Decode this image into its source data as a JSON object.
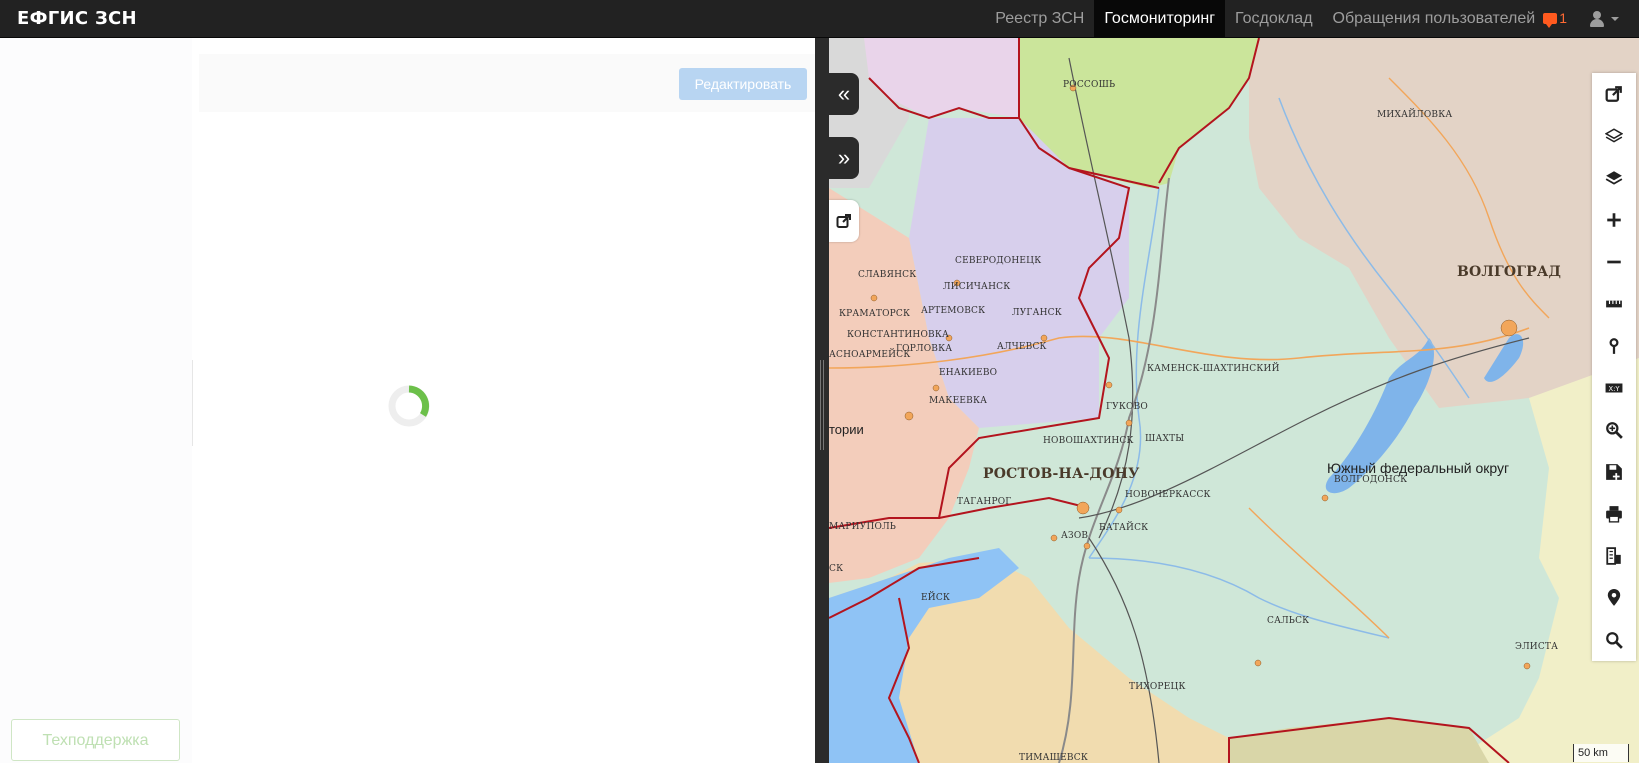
{
  "navbar": {
    "brand": "ЕФГИС ЗСН",
    "items": [
      {
        "label": "Реестр ЗСН",
        "active": false
      },
      {
        "label": "Госмониторинг",
        "active": true
      },
      {
        "label": "Госдоклад",
        "active": false
      },
      {
        "label": "Обращения пользователей",
        "active": false
      }
    ],
    "appeals_count": "1",
    "badge_color": "#ff5a1f"
  },
  "panel": {
    "edit_label": "Редактировать",
    "support_label": "Техподдержка"
  },
  "map_buttons": {
    "collapse_label": "«",
    "expand_label": "»",
    "tools": [
      "external-link-icon",
      "layers-icon",
      "layers-filled-icon",
      "zoom-in-icon",
      "zoom-out-icon",
      "ruler-icon",
      "pin-icon",
      "xy-icon",
      "magnifier-plus-icon",
      "save-icon",
      "print-icon",
      "building-icon",
      "location-icon",
      "search-icon"
    ]
  },
  "map": {
    "region_label": "Южный федеральный округ",
    "partial_label": "тории",
    "scale": "50 km",
    "cities": [
      {
        "name": "РОССОШЬ"
      },
      {
        "name": "МИХАЙЛОВКА"
      },
      {
        "name": "СЕВЕРОДОНЕЦК"
      },
      {
        "name": "СЛАВЯНСК"
      },
      {
        "name": "ЛИСИЧАНСК"
      },
      {
        "name": "КРАМАТОРСК"
      },
      {
        "name": "АРТЕМОВСК"
      },
      {
        "name": "ЛУГАНСК"
      },
      {
        "name": "КОНСТАНТИНОВКА"
      },
      {
        "name": "ГОРЛОВКА"
      },
      {
        "name": "АЛЧЕВСК"
      },
      {
        "name": "АСНОАРМЕЙСК"
      },
      {
        "name": "ЕНАКИЕВО"
      },
      {
        "name": "МАКЕЕВКА"
      },
      {
        "name": "КАМЕНСК-ШАХТИНСКИЙ"
      },
      {
        "name": "ГУКОВО"
      },
      {
        "name": "НОВОШАХТИНСК"
      },
      {
        "name": "ШАХТЫ"
      },
      {
        "name": "РОСТОВ-НА-ДОНУ",
        "big": true
      },
      {
        "name": "ТАГАНРОГ"
      },
      {
        "name": "НОВОЧЕРКАССК"
      },
      {
        "name": "ВОЛГОДОНСК"
      },
      {
        "name": "МАРИУПОЛЬ"
      },
      {
        "name": "АЗОВ"
      },
      {
        "name": "БАТАЙСК"
      },
      {
        "name": "ЕЙСК"
      },
      {
        "name": "САЛЬСК"
      },
      {
        "name": "ЭЛИСТА"
      },
      {
        "name": "ТИХОРЕЦК"
      },
      {
        "name": "ВОЛГОГРАД",
        "big": true
      },
      {
        "name": "ТИМАШЕВСК"
      },
      {
        "name": "СК"
      }
    ]
  }
}
